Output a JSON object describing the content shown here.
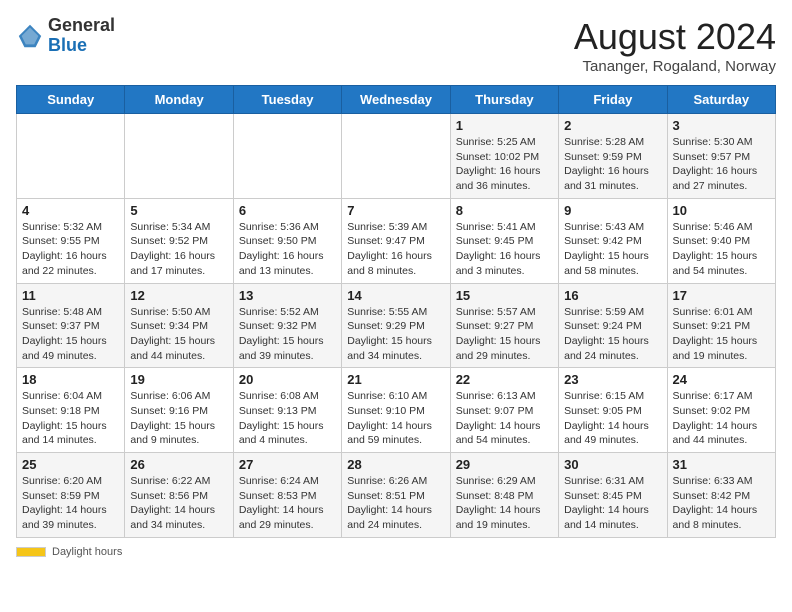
{
  "header": {
    "logo_general": "General",
    "logo_blue": "Blue",
    "month_title": "August 2024",
    "subtitle": "Tananger, Rogaland, Norway"
  },
  "weekdays": [
    "Sunday",
    "Monday",
    "Tuesday",
    "Wednesday",
    "Thursday",
    "Friday",
    "Saturday"
  ],
  "weeks": [
    [
      {
        "day": "",
        "info": ""
      },
      {
        "day": "",
        "info": ""
      },
      {
        "day": "",
        "info": ""
      },
      {
        "day": "",
        "info": ""
      },
      {
        "day": "1",
        "info": "Sunrise: 5:25 AM\nSunset: 10:02 PM\nDaylight: 16 hours and 36 minutes."
      },
      {
        "day": "2",
        "info": "Sunrise: 5:28 AM\nSunset: 9:59 PM\nDaylight: 16 hours and 31 minutes."
      },
      {
        "day": "3",
        "info": "Sunrise: 5:30 AM\nSunset: 9:57 PM\nDaylight: 16 hours and 27 minutes."
      }
    ],
    [
      {
        "day": "4",
        "info": "Sunrise: 5:32 AM\nSunset: 9:55 PM\nDaylight: 16 hours and 22 minutes."
      },
      {
        "day": "5",
        "info": "Sunrise: 5:34 AM\nSunset: 9:52 PM\nDaylight: 16 hours and 17 minutes."
      },
      {
        "day": "6",
        "info": "Sunrise: 5:36 AM\nSunset: 9:50 PM\nDaylight: 16 hours and 13 minutes."
      },
      {
        "day": "7",
        "info": "Sunrise: 5:39 AM\nSunset: 9:47 PM\nDaylight: 16 hours and 8 minutes."
      },
      {
        "day": "8",
        "info": "Sunrise: 5:41 AM\nSunset: 9:45 PM\nDaylight: 16 hours and 3 minutes."
      },
      {
        "day": "9",
        "info": "Sunrise: 5:43 AM\nSunset: 9:42 PM\nDaylight: 15 hours and 58 minutes."
      },
      {
        "day": "10",
        "info": "Sunrise: 5:46 AM\nSunset: 9:40 PM\nDaylight: 15 hours and 54 minutes."
      }
    ],
    [
      {
        "day": "11",
        "info": "Sunrise: 5:48 AM\nSunset: 9:37 PM\nDaylight: 15 hours and 49 minutes."
      },
      {
        "day": "12",
        "info": "Sunrise: 5:50 AM\nSunset: 9:34 PM\nDaylight: 15 hours and 44 minutes."
      },
      {
        "day": "13",
        "info": "Sunrise: 5:52 AM\nSunset: 9:32 PM\nDaylight: 15 hours and 39 minutes."
      },
      {
        "day": "14",
        "info": "Sunrise: 5:55 AM\nSunset: 9:29 PM\nDaylight: 15 hours and 34 minutes."
      },
      {
        "day": "15",
        "info": "Sunrise: 5:57 AM\nSunset: 9:27 PM\nDaylight: 15 hours and 29 minutes."
      },
      {
        "day": "16",
        "info": "Sunrise: 5:59 AM\nSunset: 9:24 PM\nDaylight: 15 hours and 24 minutes."
      },
      {
        "day": "17",
        "info": "Sunrise: 6:01 AM\nSunset: 9:21 PM\nDaylight: 15 hours and 19 minutes."
      }
    ],
    [
      {
        "day": "18",
        "info": "Sunrise: 6:04 AM\nSunset: 9:18 PM\nDaylight: 15 hours and 14 minutes."
      },
      {
        "day": "19",
        "info": "Sunrise: 6:06 AM\nSunset: 9:16 PM\nDaylight: 15 hours and 9 minutes."
      },
      {
        "day": "20",
        "info": "Sunrise: 6:08 AM\nSunset: 9:13 PM\nDaylight: 15 hours and 4 minutes."
      },
      {
        "day": "21",
        "info": "Sunrise: 6:10 AM\nSunset: 9:10 PM\nDaylight: 14 hours and 59 minutes."
      },
      {
        "day": "22",
        "info": "Sunrise: 6:13 AM\nSunset: 9:07 PM\nDaylight: 14 hours and 54 minutes."
      },
      {
        "day": "23",
        "info": "Sunrise: 6:15 AM\nSunset: 9:05 PM\nDaylight: 14 hours and 49 minutes."
      },
      {
        "day": "24",
        "info": "Sunrise: 6:17 AM\nSunset: 9:02 PM\nDaylight: 14 hours and 44 minutes."
      }
    ],
    [
      {
        "day": "25",
        "info": "Sunrise: 6:20 AM\nSunset: 8:59 PM\nDaylight: 14 hours and 39 minutes."
      },
      {
        "day": "26",
        "info": "Sunrise: 6:22 AM\nSunset: 8:56 PM\nDaylight: 14 hours and 34 minutes."
      },
      {
        "day": "27",
        "info": "Sunrise: 6:24 AM\nSunset: 8:53 PM\nDaylight: 14 hours and 29 minutes."
      },
      {
        "day": "28",
        "info": "Sunrise: 6:26 AM\nSunset: 8:51 PM\nDaylight: 14 hours and 24 minutes."
      },
      {
        "day": "29",
        "info": "Sunrise: 6:29 AM\nSunset: 8:48 PM\nDaylight: 14 hours and 19 minutes."
      },
      {
        "day": "30",
        "info": "Sunrise: 6:31 AM\nSunset: 8:45 PM\nDaylight: 14 hours and 14 minutes."
      },
      {
        "day": "31",
        "info": "Sunrise: 6:33 AM\nSunset: 8:42 PM\nDaylight: 14 hours and 8 minutes."
      }
    ]
  ],
  "footer": {
    "daylight_label": "Daylight hours"
  }
}
